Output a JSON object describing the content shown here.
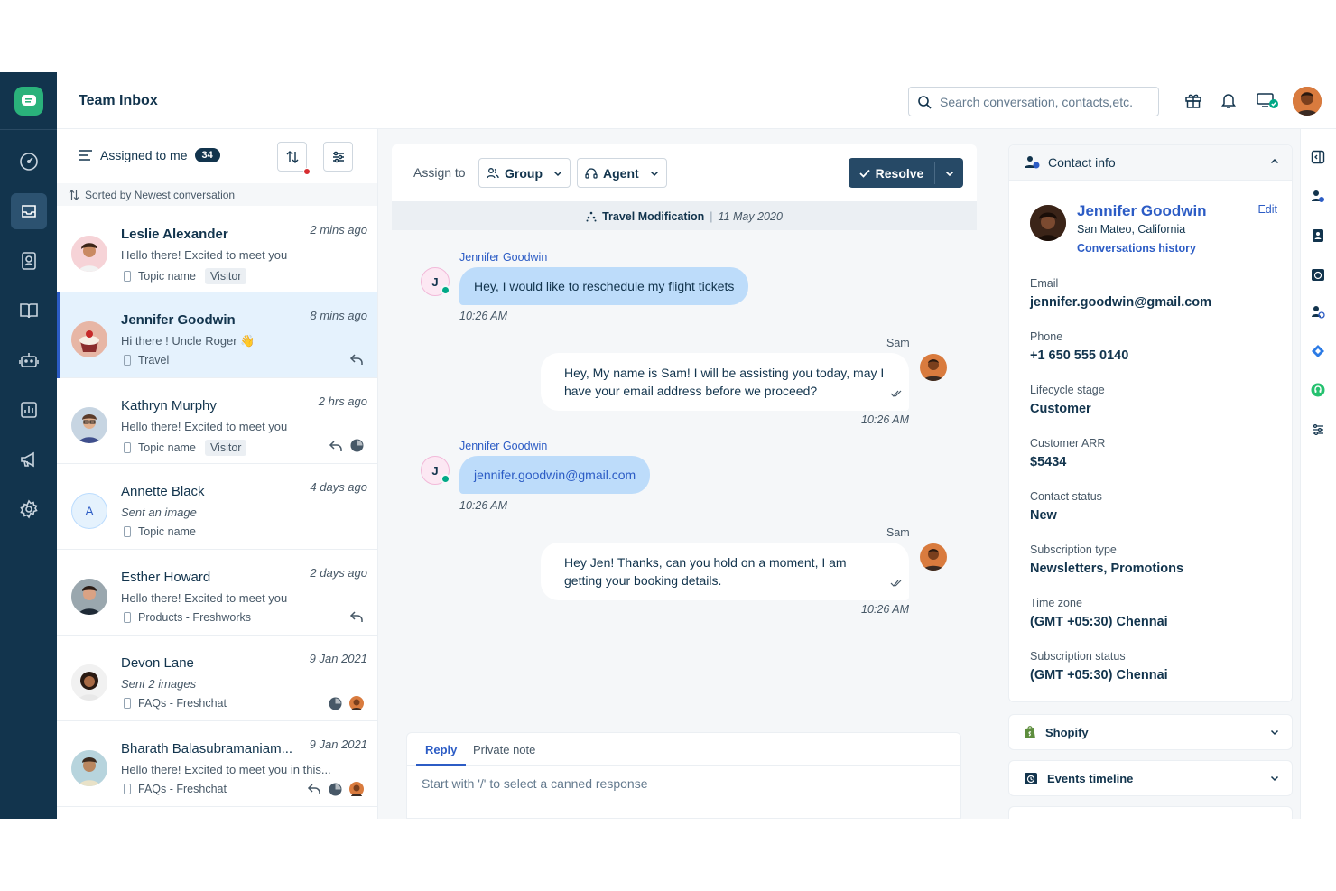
{
  "header": {
    "title": "Team Inbox",
    "search_placeholder": "Search conversation, contacts,etc."
  },
  "nav": {
    "items": [
      "dashboard-icon",
      "inbox-icon",
      "contacts-icon",
      "knowledge-base-icon",
      "bot-icon",
      "reports-icon",
      "campaigns-icon",
      "settings-icon"
    ],
    "active": "inbox-icon"
  },
  "list": {
    "filter_label": "Assigned to me",
    "filter_count": "34",
    "sort_label": "Sorted by Newest conversation",
    "conversations": [
      {
        "name": "Leslie Alexander",
        "time": "2 mins ago",
        "message": "Hello there! Excited to meet you",
        "topic": "Topic name",
        "tag": "Visitor"
      },
      {
        "name": "Jennifer Goodwin",
        "time": "8 mins ago",
        "message": "Hi there ! Uncle Roger 👋",
        "topic": "Travel",
        "tag": ""
      },
      {
        "name": "Kathryn Murphy",
        "time": "2 hrs ago",
        "message": "Hello there! Excited to meet you",
        "topic": "Topic name",
        "tag": "Visitor"
      },
      {
        "name": "Annette Black",
        "time": "4 days ago",
        "message": "Sent an image",
        "topic": "Topic name",
        "tag": "",
        "initial": "A"
      },
      {
        "name": "Esther Howard",
        "time": "2 days ago",
        "message": "Hello there! Excited to meet you",
        "topic": "Products - Freshworks",
        "tag": ""
      },
      {
        "name": "Devon Lane",
        "time": "9 Jan 2021",
        "message": "Sent 2 images",
        "topic": "FAQs - Freshchat",
        "tag": ""
      },
      {
        "name": "Bharath Balasubramaniam...",
        "time": "9 Jan 2021",
        "message": "Hello there! Excited to meet you in this...",
        "topic": "FAQs - Freshchat",
        "tag": ""
      }
    ]
  },
  "chat": {
    "assign_label": "Assign to",
    "group_label": "Group",
    "agent_label": "Agent",
    "resolve_label": "Resolve",
    "topic": "Travel Modification",
    "topic_date": "11 May 2020",
    "messages": [
      {
        "from": "Jennifer Goodwin",
        "initial": "J",
        "text": "Hey, I would like to reschedule my flight tickets",
        "time": "10:26 AM"
      },
      {
        "from": "Sam",
        "text": "Hey, My name is Sam! I will be assisting you today, may I have your email address before we proceed?",
        "time": "10:26 AM"
      },
      {
        "from": "Jennifer Goodwin",
        "initial": "J",
        "text": "jennifer.goodwin@gmail.com",
        "time": "10:26 AM"
      },
      {
        "from": "Sam",
        "text": "Hey Jen! Thanks, can you hold on a moment, I am getting your booking details.",
        "time": "10:26 AM"
      }
    ],
    "reply_tab": "Reply",
    "note_tab": "Private note",
    "reply_placeholder": "Start with '/' to select a canned response"
  },
  "contact": {
    "section_title": "Contact info",
    "name": "Jennifer Goodwin",
    "edit_label": "Edit",
    "location": "San Mateo, California",
    "history_link": "Conversations history",
    "fields": [
      {
        "label": "Email",
        "value": "jennifer.goodwin@gmail.com"
      },
      {
        "label": "Phone",
        "value": "+1 650 555 0140"
      },
      {
        "label": "Lifecycle stage",
        "value": "Customer"
      },
      {
        "label": "Customer ARR",
        "value": "$5434"
      },
      {
        "label": "Contact status",
        "value": "New"
      },
      {
        "label": "Subscription type",
        "value": "Newsletters, Promotions"
      },
      {
        "label": "Time zone",
        "value": "(GMT +05:30) Chennai"
      },
      {
        "label": "Subscription status",
        "value": "(GMT +05:30) Chennai"
      }
    ],
    "shopify_label": "Shopify",
    "events_label": "Events timeline"
  },
  "colors": {
    "nav_bg": "#12344d",
    "accent": "#2c5cc5",
    "brand_green": "#2ab27b",
    "user_bubble": "#bddcfa",
    "resolve_bg": "#264966"
  }
}
